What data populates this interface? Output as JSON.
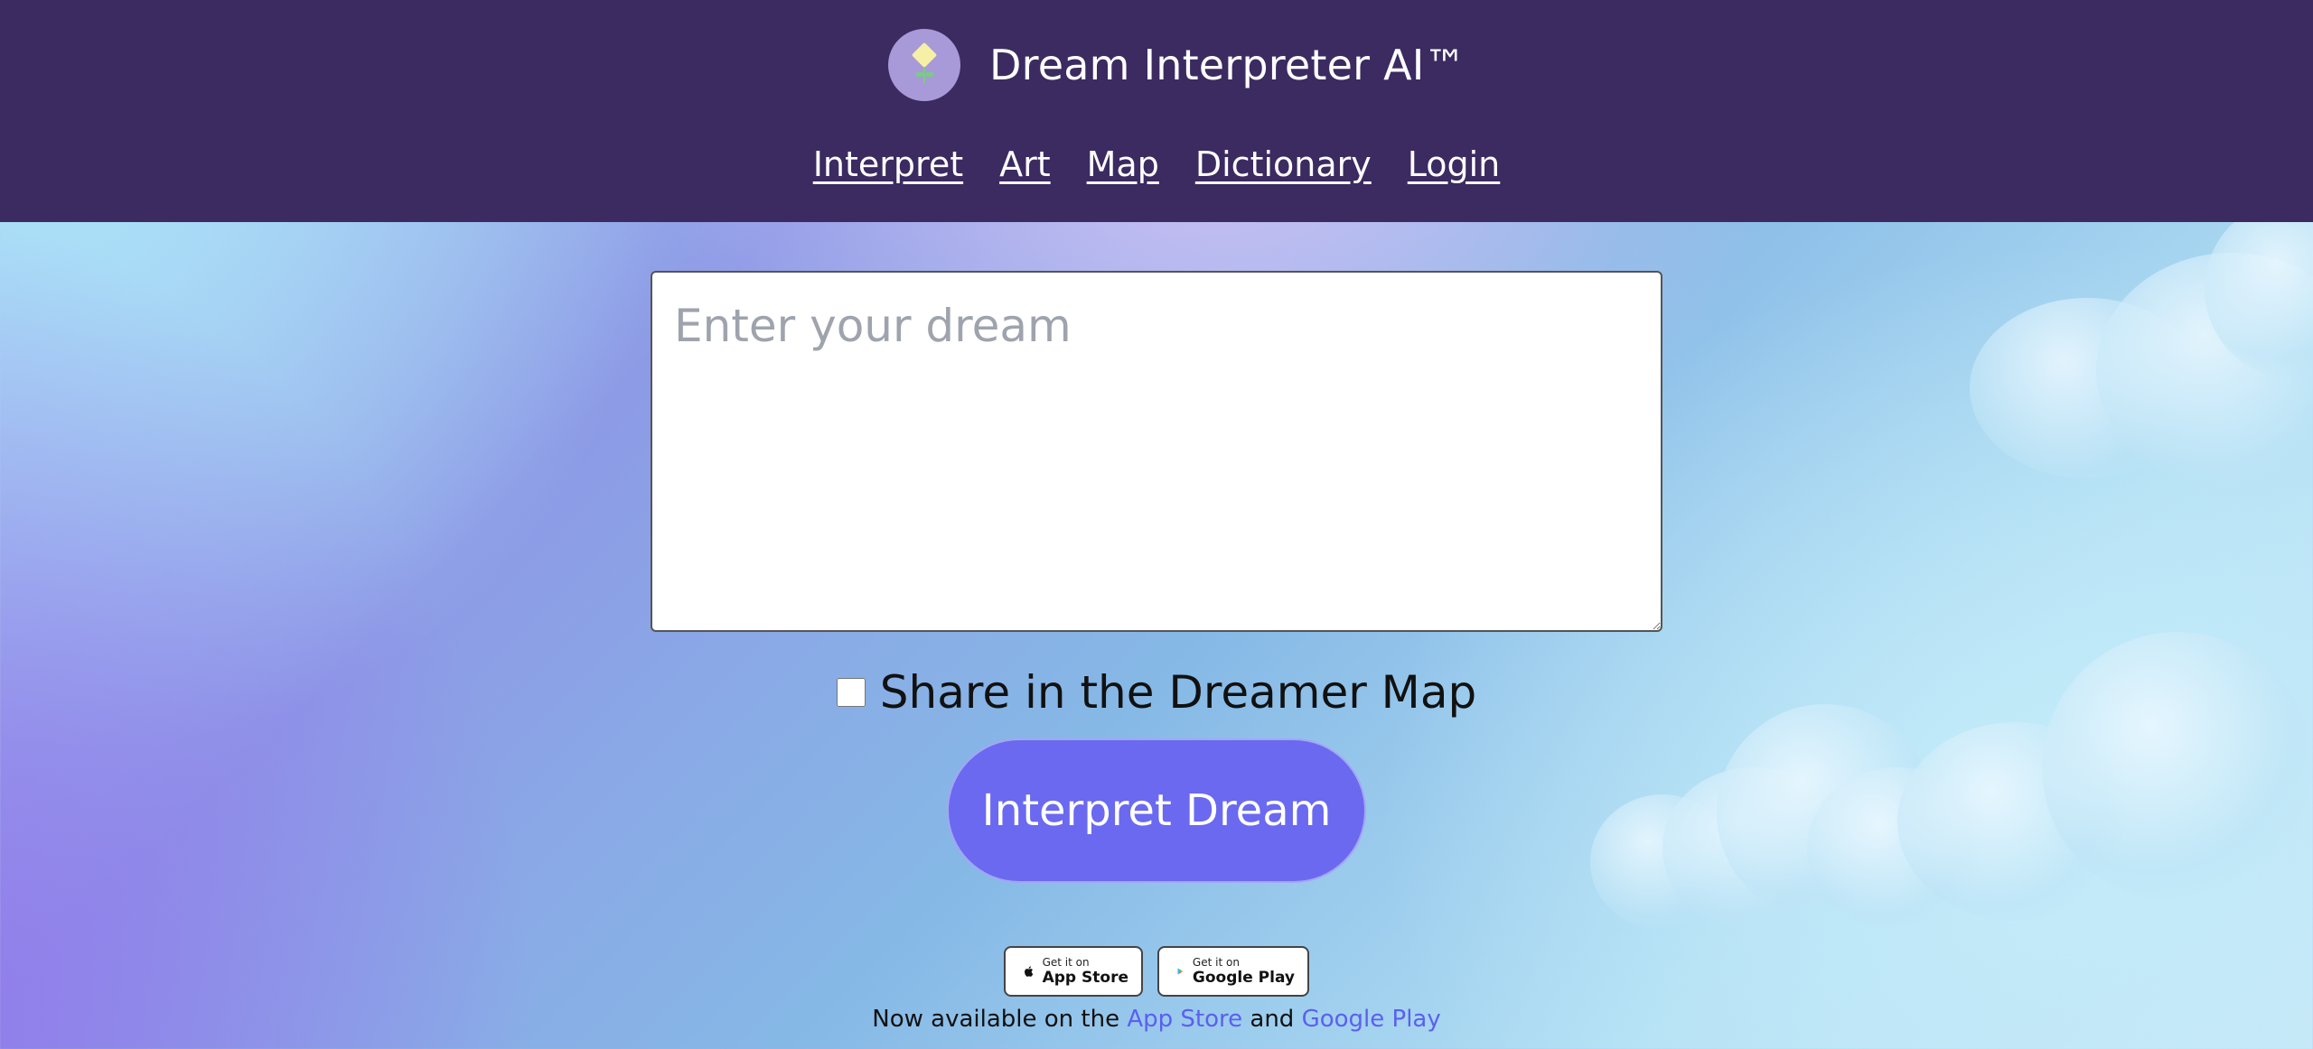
{
  "header": {
    "title": "Dream Interpreter AI™",
    "nav": [
      {
        "label": "Interpret"
      },
      {
        "label": "Art"
      },
      {
        "label": "Map"
      },
      {
        "label": "Dictionary"
      },
      {
        "label": "Login"
      }
    ]
  },
  "main": {
    "dream_input": {
      "placeholder": "Enter your dream",
      "value": ""
    },
    "share_checkbox": {
      "label": "Share in the Dreamer Map",
      "checked": false
    },
    "interpret_button": "Interpret Dream"
  },
  "footer": {
    "badges": {
      "apple": {
        "small": "Get it on",
        "big": "App Store"
      },
      "google": {
        "small": "Get it on",
        "big": "Google Play"
      }
    },
    "available_prefix": "Now available on the",
    "app_store_link": "App Store",
    "and": "and",
    "google_play_link": "Google Play"
  },
  "colors": {
    "header_bg": "#3b2b61",
    "button_bg": "#6a69f0",
    "link": "#5b5ff0"
  }
}
